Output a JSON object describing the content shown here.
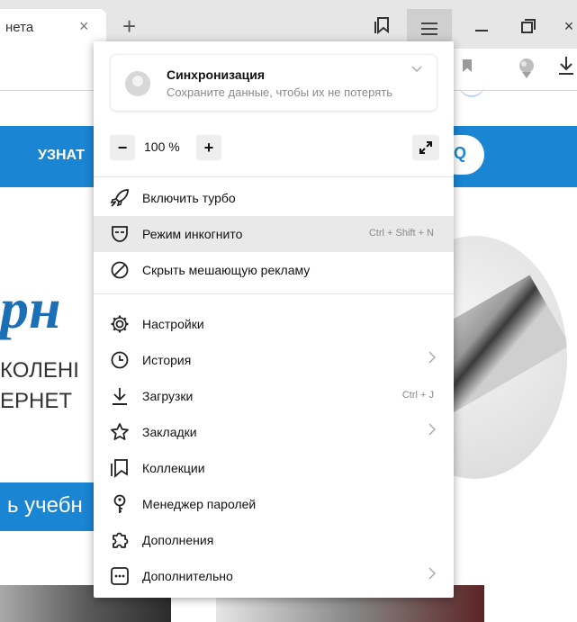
{
  "tabbar": {
    "tab_title": "нета",
    "tab_close": "×",
    "new_tab": "+",
    "close_window": "×"
  },
  "page": {
    "hero_button": "УЗНАТ",
    "big_word": "рн",
    "sub_line1": "КОЛЕНІ",
    "sub_line2": "ЕРНЕТ",
    "learn_button": "ь учебн",
    "accent_color": "#1a85d2"
  },
  "menu": {
    "sync": {
      "title": "Синхронизация",
      "subtitle": "Сохраните данные, чтобы их не потерять"
    },
    "zoom": {
      "minus": "−",
      "value": "100 %",
      "plus": "+"
    },
    "items": [
      {
        "label": "Включить турбо",
        "shortcut": "",
        "icon": "rocket-icon"
      },
      {
        "label": "Режим инкогнито",
        "shortcut": "Ctrl + Shift + N",
        "icon": "incognito-icon"
      },
      {
        "label": "Скрыть мешающую рекламу",
        "shortcut": "",
        "icon": "block-icon"
      },
      {
        "label": "Настройки",
        "shortcut": "",
        "icon": "gear-icon"
      },
      {
        "label": "История",
        "shortcut": "",
        "icon": "clock-icon"
      },
      {
        "label": "Загрузки",
        "shortcut": "Ctrl + J",
        "icon": "download-icon"
      },
      {
        "label": "Закладки",
        "shortcut": "",
        "icon": "star-icon"
      },
      {
        "label": "Коллекции",
        "shortcut": "",
        "icon": "collections-icon"
      },
      {
        "label": "Менеджер паролей",
        "shortcut": "",
        "icon": "key-icon"
      },
      {
        "label": "Дополнения",
        "shortcut": "",
        "icon": "puzzle-icon"
      },
      {
        "label": "Дополнительно",
        "shortcut": "",
        "icon": "more-icon"
      }
    ]
  }
}
